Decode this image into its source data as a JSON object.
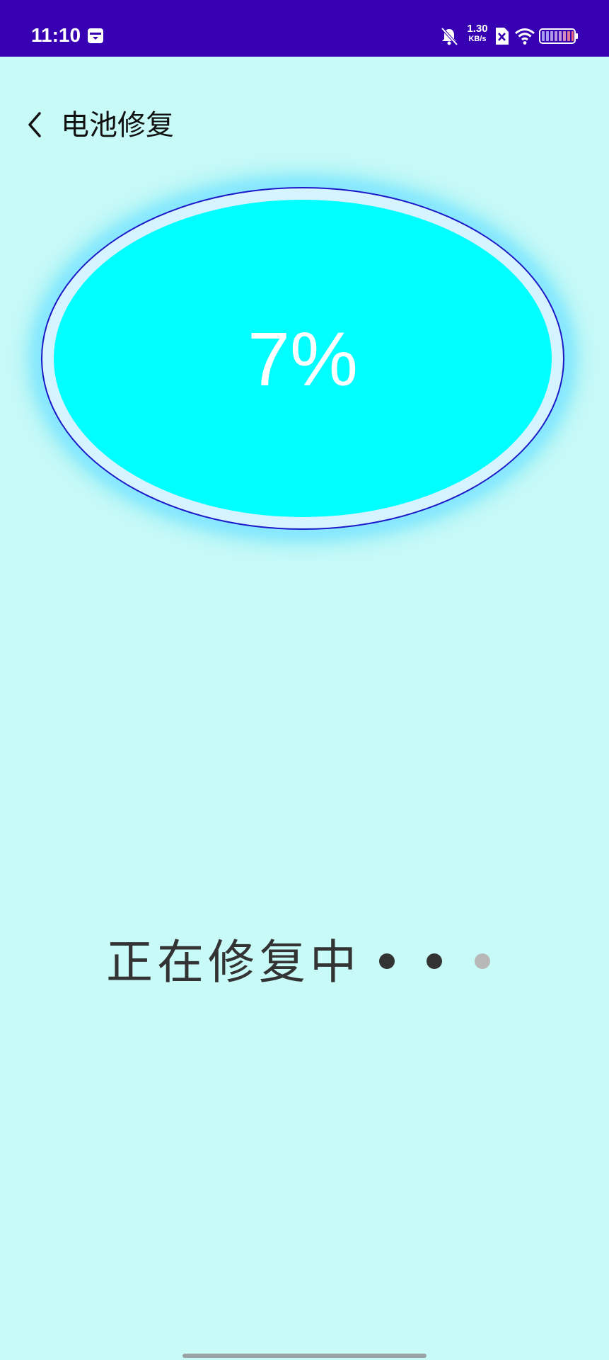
{
  "status_bar": {
    "time": "11:10",
    "net_speed_value": "1.30",
    "net_speed_unit": "KB/s",
    "background_color": "#3700b3"
  },
  "header": {
    "title": "电池修复",
    "back_icon": "chevron-left-icon"
  },
  "progress": {
    "value": 7,
    "label": "7%",
    "fill_color": "#00ffff",
    "ring_color": "#1c19c8"
  },
  "repair_status": {
    "text": "正在修复中",
    "animation_dots_active": 2,
    "animation_dots_total": 3,
    "dot_active_color": "#333333",
    "dot_inactive_color": "#b8b8b8"
  },
  "colors": {
    "background": "#c8faf7"
  }
}
